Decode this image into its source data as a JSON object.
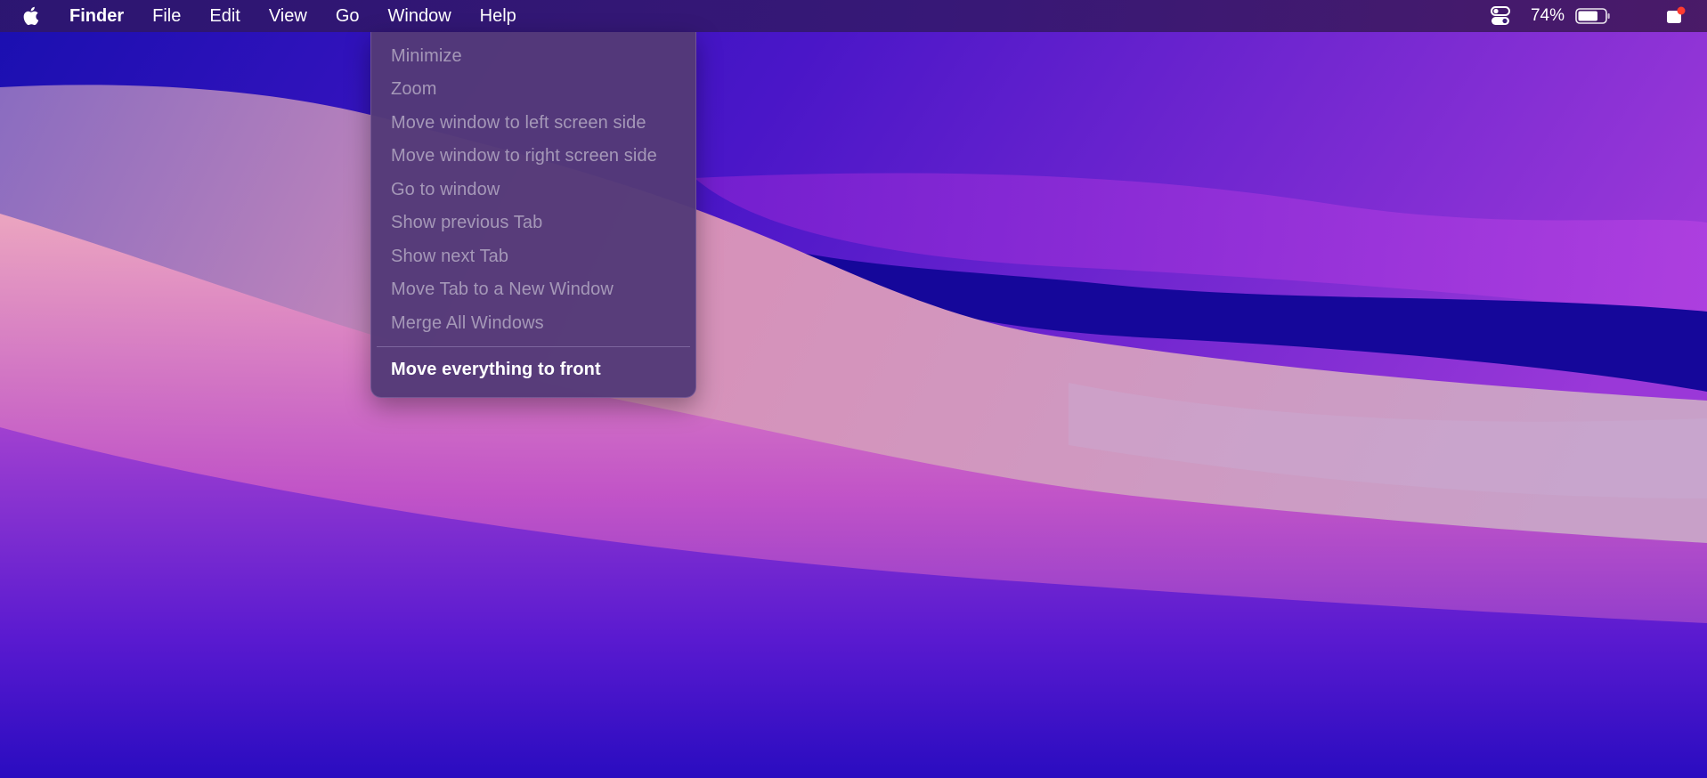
{
  "menubar": {
    "apple_icon": "apple-logo-icon",
    "app_name": "Finder",
    "items": [
      {
        "label": "File"
      },
      {
        "label": "Edit"
      },
      {
        "label": "View"
      },
      {
        "label": "Go"
      },
      {
        "label": "Window"
      },
      {
        "label": "Help"
      }
    ],
    "status": {
      "control_center_icon": "toggle-switches-icon",
      "battery_percent": "74%",
      "battery_level": 0.74,
      "notification_icon": "notification-center-icon"
    }
  },
  "window_menu": {
    "items": [
      {
        "label": "Minimize",
        "enabled": false
      },
      {
        "label": "Zoom",
        "enabled": false
      },
      {
        "label": "Move window to left screen side",
        "enabled": false
      },
      {
        "label": "Move window to right screen side",
        "enabled": false
      },
      {
        "label": "Go to window",
        "enabled": false
      },
      {
        "label": "Show previous Tab",
        "enabled": false
      },
      {
        "label": "Show next Tab",
        "enabled": false
      },
      {
        "label": "Move Tab to a New Window",
        "enabled": false
      },
      {
        "label": "Merge All Windows",
        "enabled": false
      },
      {
        "label": "Move everything to front",
        "enabled": true
      }
    ]
  },
  "colors": {
    "menu_background": "#54387a",
    "disabled_text": "#a598b8",
    "enabled_text": "#ffffff",
    "badge_red": "#ff3b30"
  }
}
